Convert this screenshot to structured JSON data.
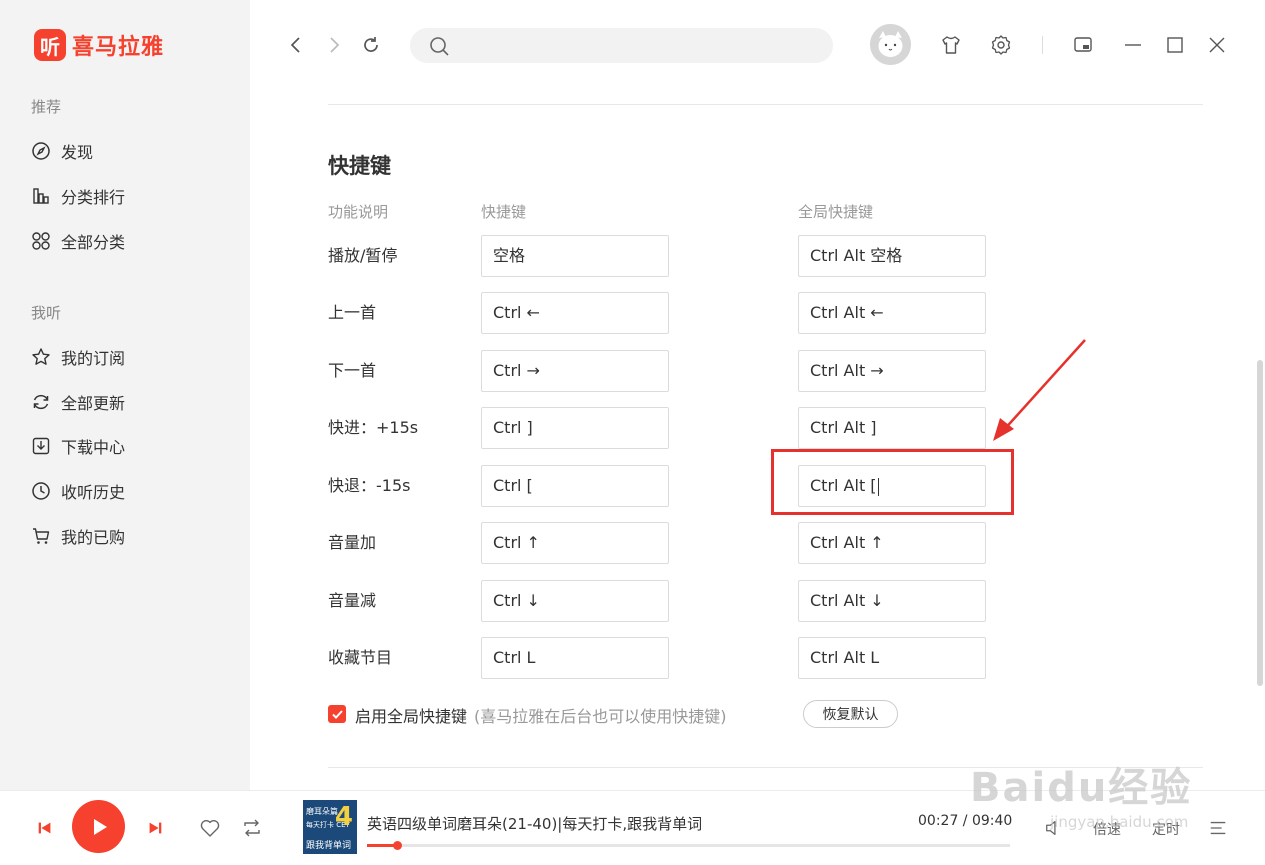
{
  "app": {
    "logo_mark": "听",
    "logo_text": "喜马拉雅",
    "brand_color": "#f5412d"
  },
  "sidebar": {
    "section_recommend": "推荐",
    "recommend_items": [
      {
        "label": "发现",
        "icon": "compass-icon"
      },
      {
        "label": "分类排行",
        "icon": "bar-chart-icon"
      },
      {
        "label": "全部分类",
        "icon": "grid-icon"
      }
    ],
    "section_mine": "我听",
    "mine_items": [
      {
        "label": "我的订阅",
        "icon": "star-icon"
      },
      {
        "label": "全部更新",
        "icon": "refresh-icon"
      },
      {
        "label": "下载中心",
        "icon": "download-icon"
      },
      {
        "label": "收听历史",
        "icon": "clock-icon"
      },
      {
        "label": "我的已购",
        "icon": "cart-icon"
      }
    ]
  },
  "topbar": {
    "search_placeholder": "",
    "icons": [
      "back-icon",
      "forward-icon",
      "reload-icon",
      "skin-shirt-icon",
      "settings-gear-icon",
      "mini-mode-icon",
      "minimize-icon",
      "maximize-icon",
      "close-icon"
    ]
  },
  "shortcuts": {
    "title": "快捷键",
    "col_function": "功能说明",
    "col_shortcut": "快捷键",
    "col_global": "全局快捷键",
    "rows": [
      {
        "label": "播放/暂停",
        "key": "空格",
        "global": "Ctrl Alt 空格"
      },
      {
        "label": "上一首",
        "key": "Ctrl ←",
        "global": "Ctrl Alt ←"
      },
      {
        "label": "下一首",
        "key": "Ctrl →",
        "global": "Ctrl Alt →"
      },
      {
        "label": "快进：+15s",
        "key": "Ctrl ]",
        "global": "Ctrl Alt ]"
      },
      {
        "label": "快退：-15s",
        "key": "Ctrl [",
        "global": "Ctrl Alt ["
      },
      {
        "label": "音量加",
        "key": "Ctrl ↑",
        "global": "Ctrl Alt ↑"
      },
      {
        "label": "音量减",
        "key": "Ctrl ↓",
        "global": "Ctrl Alt ↓"
      },
      {
        "label": "收藏节目",
        "key": "Ctrl L",
        "global": "Ctrl Alt L"
      }
    ],
    "enable_global_label": "启用全局快捷键",
    "enable_global_hint": "(喜马拉雅在后台也可以使用快捷键)",
    "enable_global_checked": true,
    "reset_label": "恢复默认"
  },
  "player": {
    "cover_big": "4",
    "cover_line1": "磨耳朵篇",
    "cover_line2": "每天打卡 CET",
    "cover_line3": "跟我背单词",
    "track_title": "英语四级单词磨耳朵(21-40)|每天打卡,跟我背单词",
    "time": "00:27 / 09:40",
    "progress": 0.047,
    "speed_label": "倍速",
    "timer_label": "定时"
  },
  "watermark": {
    "main": "Baidu经验",
    "url": "jingyan.baidu.com"
  }
}
